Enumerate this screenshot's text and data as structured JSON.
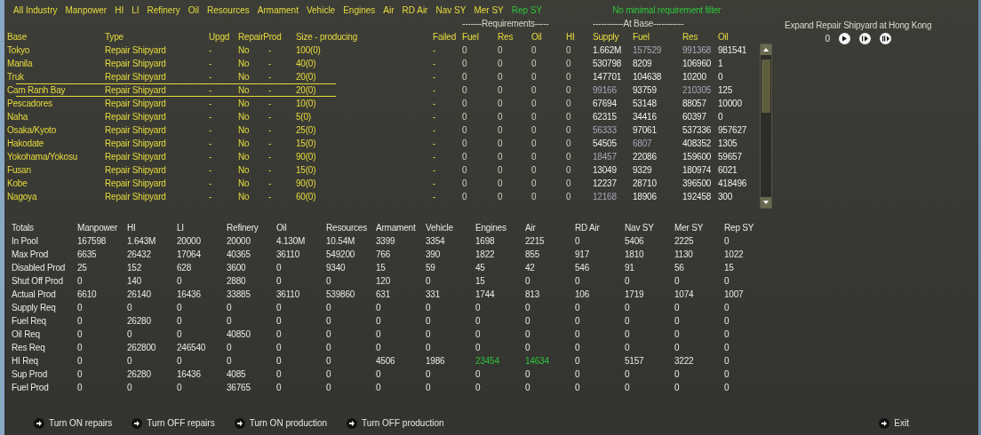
{
  "filters": [
    {
      "label": "All Industry",
      "selected": false
    },
    {
      "label": "Manpower",
      "selected": false
    },
    {
      "label": "HI",
      "selected": false
    },
    {
      "label": "LI",
      "selected": false
    },
    {
      "label": "Refinery",
      "selected": false
    },
    {
      "label": "Oil",
      "selected": false
    },
    {
      "label": "Resources",
      "selected": false
    },
    {
      "label": "Armament",
      "selected": false
    },
    {
      "label": "Vehicle",
      "selected": false
    },
    {
      "label": "Engines",
      "selected": false
    },
    {
      "label": "Air",
      "selected": false
    },
    {
      "label": "RD Air",
      "selected": false
    },
    {
      "label": "Nav SY",
      "selected": false
    },
    {
      "label": "Mer SY",
      "selected": false
    },
    {
      "label": "Rep SY",
      "selected": true
    }
  ],
  "filter_note": "No minimal requirement filter",
  "group_headers": {
    "requirements": "-------Requirements-----",
    "at_base": "-----------At Base-----------"
  },
  "columns": [
    "Base",
    "Type",
    "Upgd",
    "RepairProd",
    "Size - producing",
    "Failed",
    "Fuel",
    "Res",
    "Oil",
    "HI",
    "Supply",
    "Fuel",
    "Res",
    "Oil"
  ],
  "rows": [
    {
      "base": "Tokyo",
      "type": "Repair Shipyard",
      "upgd": "-",
      "repair": "No",
      "prod": "-",
      "size": "100(0)",
      "failed": "-",
      "req": [
        "0",
        "0",
        "0",
        "0"
      ],
      "at_base": [
        "1.662M",
        "157529",
        "991368",
        "981541"
      ],
      "dim": [
        false,
        true,
        true,
        false
      ],
      "selected": false
    },
    {
      "base": "Manila",
      "type": "Repair Shipyard",
      "upgd": "-",
      "repair": "No",
      "prod": "-",
      "size": "40(0)",
      "failed": "-",
      "req": [
        "0",
        "0",
        "0",
        "0"
      ],
      "at_base": [
        "530798",
        "8209",
        "106960",
        "1"
      ],
      "dim": [
        false,
        false,
        false,
        false
      ],
      "selected": false
    },
    {
      "base": "Truk",
      "type": "Repair Shipyard",
      "upgd": "-",
      "repair": "No",
      "prod": "-",
      "size": "20(0)",
      "failed": "-",
      "req": [
        "0",
        "0",
        "0",
        "0"
      ],
      "at_base": [
        "147701",
        "104638",
        "10200",
        "0"
      ],
      "dim": [
        false,
        false,
        false,
        false
      ],
      "selected": false
    },
    {
      "base": "Cam Ranh Bay",
      "type": "Repair Shipyard",
      "upgd": "-",
      "repair": "No",
      "prod": "-",
      "size": "20(0)",
      "failed": "-",
      "req": [
        "0",
        "0",
        "0",
        "0"
      ],
      "at_base": [
        "99166",
        "93759",
        "210305",
        "125"
      ],
      "dim": [
        true,
        false,
        true,
        false
      ],
      "selected": true
    },
    {
      "base": "Pescadores",
      "type": "Repair Shipyard",
      "upgd": "-",
      "repair": "No",
      "prod": "-",
      "size": "10(0)",
      "failed": "-",
      "req": [
        "0",
        "0",
        "0",
        "0"
      ],
      "at_base": [
        "67694",
        "53148",
        "88057",
        "10000"
      ],
      "dim": [
        false,
        false,
        false,
        false
      ],
      "selected": false
    },
    {
      "base": "Naha",
      "type": "Repair Shipyard",
      "upgd": "-",
      "repair": "No",
      "prod": "-",
      "size": "5(0)",
      "failed": "-",
      "req": [
        "0",
        "0",
        "0",
        "0"
      ],
      "at_base": [
        "62315",
        "34416",
        "60397",
        "0"
      ],
      "dim": [
        false,
        false,
        false,
        false
      ],
      "selected": false
    },
    {
      "base": "Osaka/Kyoto",
      "type": "Repair Shipyard",
      "upgd": "-",
      "repair": "No",
      "prod": "-",
      "size": "25(0)",
      "failed": "-",
      "req": [
        "0",
        "0",
        "0",
        "0"
      ],
      "at_base": [
        "56333",
        "97061",
        "537336",
        "957627"
      ],
      "dim": [
        true,
        false,
        false,
        false
      ],
      "selected": false
    },
    {
      "base": "Hakodate",
      "type": "Repair Shipyard",
      "upgd": "-",
      "repair": "No",
      "prod": "-",
      "size": "15(0)",
      "failed": "-",
      "req": [
        "0",
        "0",
        "0",
        "0"
      ],
      "at_base": [
        "54505",
        "6807",
        "408352",
        "1305"
      ],
      "dim": [
        false,
        true,
        false,
        false
      ],
      "selected": false
    },
    {
      "base": "Yokohama/Yokosu",
      "type": "Repair Shipyard",
      "upgd": "-",
      "repair": "No",
      "prod": "-",
      "size": "90(0)",
      "failed": "-",
      "req": [
        "0",
        "0",
        "0",
        "0"
      ],
      "at_base": [
        "18457",
        "22086",
        "159600",
        "59657"
      ],
      "dim": [
        true,
        false,
        false,
        false
      ],
      "selected": false
    },
    {
      "base": "Fusan",
      "type": "Repair Shipyard",
      "upgd": "-",
      "repair": "No",
      "prod": "-",
      "size": "15(0)",
      "failed": "-",
      "req": [
        "0",
        "0",
        "0",
        "0"
      ],
      "at_base": [
        "13049",
        "9329",
        "180974",
        "6021"
      ],
      "dim": [
        false,
        false,
        false,
        false
      ],
      "selected": false
    },
    {
      "base": "Kobe",
      "type": "Repair Shipyard",
      "upgd": "-",
      "repair": "No",
      "prod": "-",
      "size": "90(0)",
      "failed": "-",
      "req": [
        "0",
        "0",
        "0",
        "0"
      ],
      "at_base": [
        "12237",
        "28710",
        "396500",
        "418496"
      ],
      "dim": [
        false,
        false,
        false,
        false
      ],
      "selected": false
    },
    {
      "base": "Nagoya",
      "type": "Repair Shipyard",
      "upgd": "-",
      "repair": "No",
      "prod": "-",
      "size": "60(0)",
      "failed": "-",
      "req": [
        "0",
        "0",
        "0",
        "0"
      ],
      "at_base": [
        "12168",
        "18906",
        "192458",
        "300"
      ],
      "dim": [
        true,
        false,
        false,
        false
      ],
      "selected": false
    }
  ],
  "expand": {
    "title": "Expand Repair Shipyard at Hong Kong",
    "count": "0"
  },
  "totals": {
    "columns": [
      "Totals",
      "Manpower",
      "HI",
      "LI",
      "Refinery",
      "Oil",
      "Resources",
      "Armament",
      "Vehicle",
      "Engines",
      "Air",
      "RD Air",
      "Nav SY",
      "Mer SY",
      "Rep SY"
    ],
    "rows": [
      {
        "label": "In Pool",
        "values": [
          "167598",
          "1.643M",
          "20000",
          "20000",
          "4.130M",
          "10.54M",
          "3399",
          "3354",
          "1698",
          "2215",
          "0",
          "5406",
          "2225",
          "0"
        ]
      },
      {
        "label": "Max Prod",
        "values": [
          "6635",
          "26432",
          "17064",
          "40365",
          "36110",
          "549200",
          "766",
          "390",
          "1822",
          "855",
          "917",
          "1810",
          "1130",
          "1022"
        ]
      },
      {
        "label": "Disabled Prod",
        "values": [
          "25",
          "152",
          "628",
          "3600",
          "0",
          "9340",
          "15",
          "59",
          "45",
          "42",
          "546",
          "91",
          "56",
          "15"
        ]
      },
      {
        "label": "Shut Off Prod",
        "values": [
          "0",
          "140",
          "0",
          "2880",
          "0",
          "0",
          "120",
          "0",
          "15",
          "0",
          "0",
          "0",
          "0",
          "0"
        ]
      },
      {
        "label": "Actual Prod",
        "values": [
          "6610",
          "26140",
          "16436",
          "33885",
          "36110",
          "539860",
          "631",
          "331",
          "1744",
          "813",
          "106",
          "1719",
          "1074",
          "1007"
        ]
      },
      {
        "label": "Supply Req",
        "values": [
          "0",
          "0",
          "0",
          "0",
          "0",
          "0",
          "0",
          "0",
          "0",
          "0",
          "0",
          "0",
          "0",
          "0"
        ]
      },
      {
        "label": "Fuel Req",
        "values": [
          "0",
          "26280",
          "0",
          "0",
          "0",
          "0",
          "0",
          "0",
          "0",
          "0",
          "0",
          "0",
          "0",
          "0"
        ]
      },
      {
        "label": "Oil Req",
        "values": [
          "0",
          "0",
          "0",
          "40850",
          "0",
          "0",
          "0",
          "0",
          "0",
          "0",
          "0",
          "0",
          "0",
          "0"
        ]
      },
      {
        "label": "Res Req",
        "values": [
          "0",
          "262800",
          "246540",
          "0",
          "0",
          "0",
          "0",
          "0",
          "0",
          "0",
          "0",
          "0",
          "0",
          "0"
        ]
      },
      {
        "label": "HI Req",
        "values": [
          "0",
          "0",
          "0",
          "0",
          "0",
          "0",
          "4506",
          "1986",
          "23454",
          "14634",
          "0",
          "5157",
          "3222",
          "0"
        ],
        "highlight": [
          false,
          false,
          false,
          false,
          false,
          false,
          false,
          false,
          true,
          true,
          false,
          false,
          false,
          false
        ]
      },
      {
        "label": "Sup Prod",
        "values": [
          "0",
          "26280",
          "16436",
          "4085",
          "0",
          "0",
          "0",
          "0",
          "0",
          "0",
          "0",
          "0",
          "0",
          "0"
        ]
      },
      {
        "label": "Fuel Prod",
        "values": [
          "0",
          "0",
          "0",
          "36765",
          "0",
          "0",
          "0",
          "0",
          "0",
          "0",
          "0",
          "0",
          "0",
          "0"
        ]
      }
    ]
  },
  "actions": [
    "Turn ON repairs",
    "Turn OFF repairs",
    "Turn ON production",
    "Turn OFF production"
  ],
  "exit": "Exit"
}
